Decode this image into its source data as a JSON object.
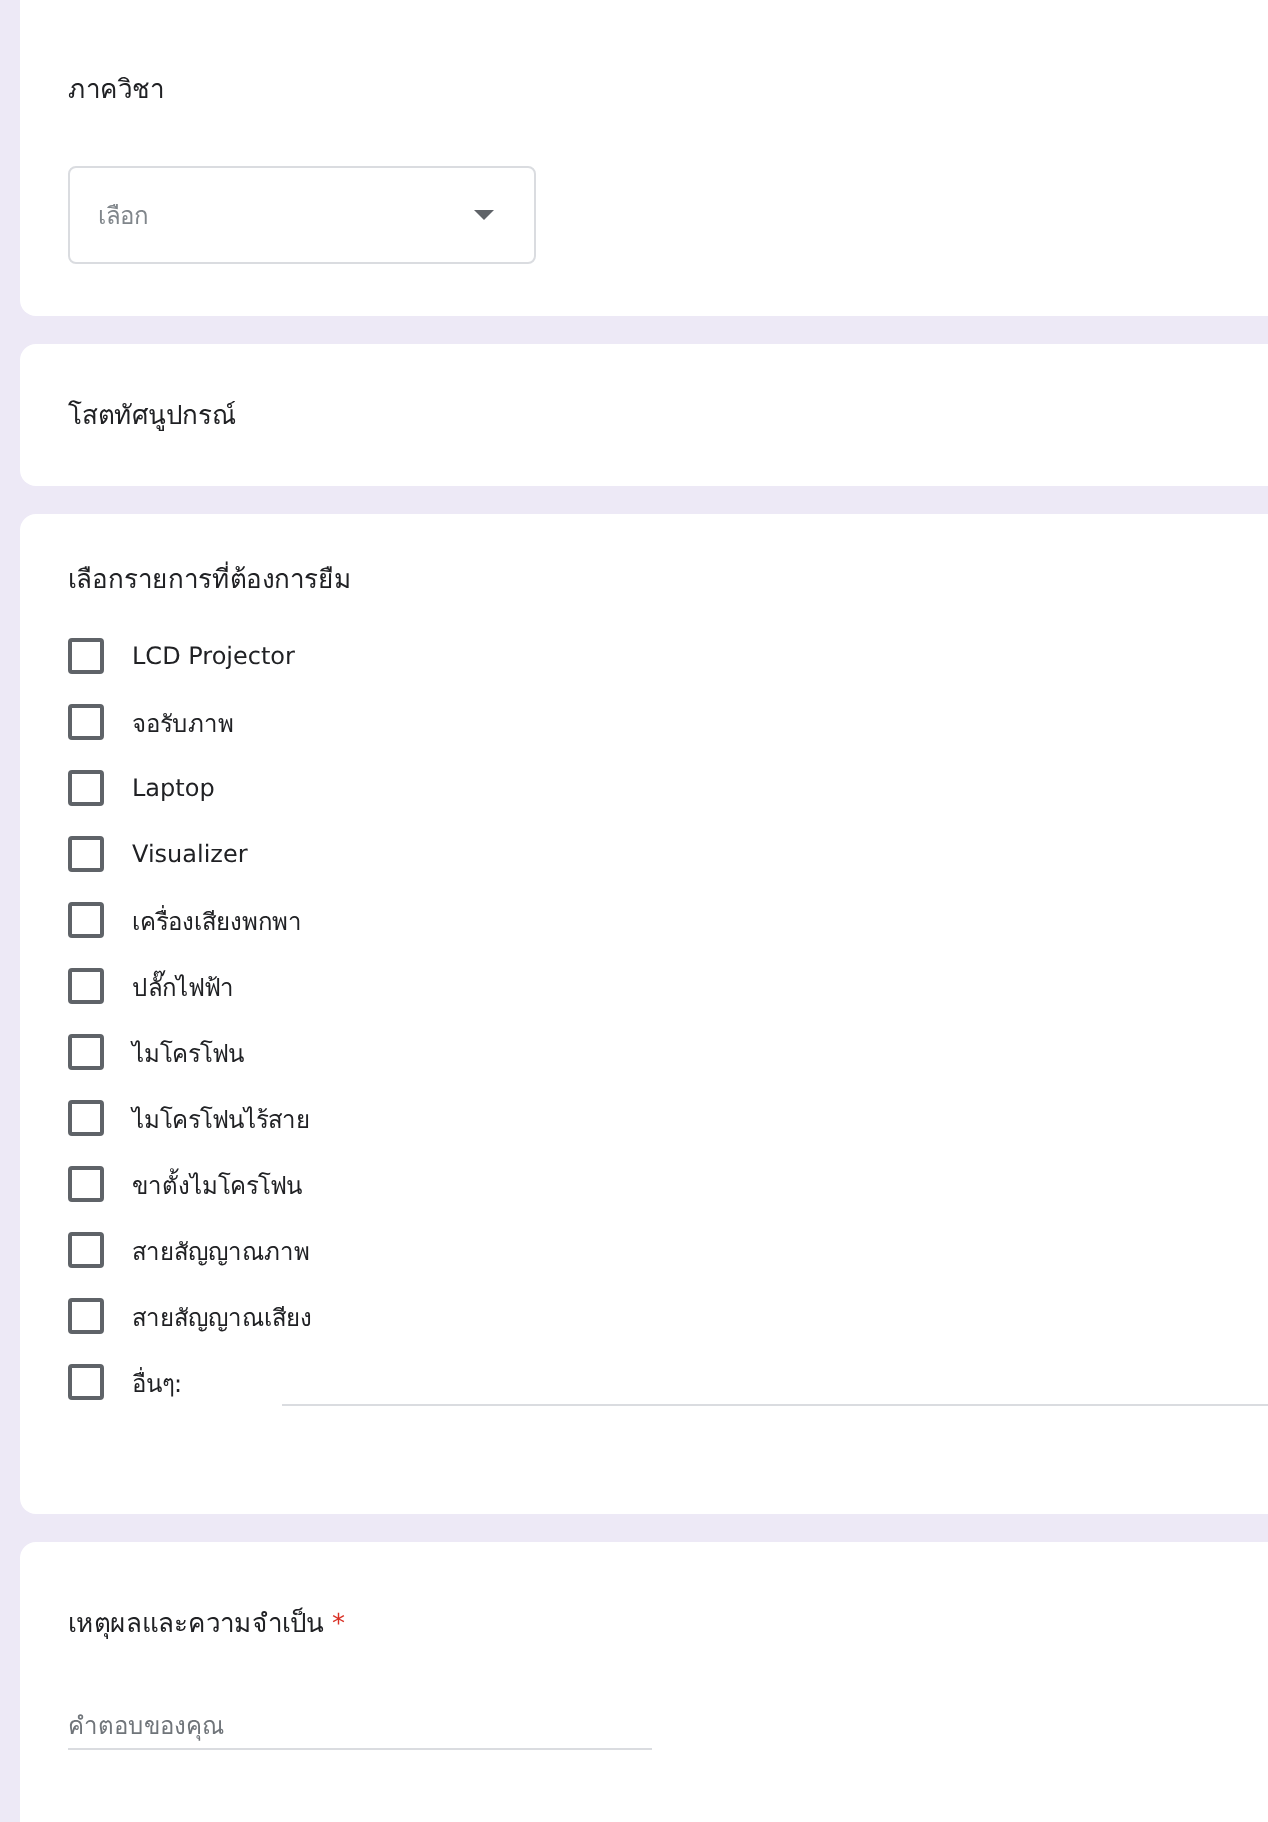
{
  "department": {
    "label": "ภาควิชา",
    "dropdown": {
      "placeholder": "เลือก"
    }
  },
  "section": {
    "title": "โสตทัศนูปกรณ์"
  },
  "equipment": {
    "label": "เลือกรายการที่ต้องการยืม",
    "options": [
      {
        "kind": "option",
        "label": "LCD Projector",
        "checked": false
      },
      {
        "kind": "option",
        "label": "จอรับภาพ",
        "checked": false
      },
      {
        "kind": "option",
        "label": "Laptop",
        "checked": false
      },
      {
        "kind": "option",
        "label": "Visualizer",
        "checked": false
      },
      {
        "kind": "option",
        "label": "เครื่องเสียงพกพา",
        "checked": false
      },
      {
        "kind": "option",
        "label": "ปลั๊กไฟฟ้า",
        "checked": false
      },
      {
        "kind": "option",
        "label": "ไมโครโฟน",
        "checked": false
      },
      {
        "kind": "option",
        "label": "ไมโครโฟนไร้สาย",
        "checked": false
      },
      {
        "kind": "option",
        "label": "ขาตั้งไมโครโฟน",
        "checked": false
      },
      {
        "kind": "option",
        "label": "สายสัญญาณภาพ",
        "checked": false
      },
      {
        "kind": "option",
        "label": "สายสัญญาณเสียง",
        "checked": false
      },
      {
        "kind": "other",
        "label": "อื่นๆ:",
        "checked": false
      }
    ]
  },
  "reason": {
    "label": "เหตุผลและความจำเป็น",
    "required": true,
    "required_mark": "*",
    "placeholder": "คำตอบของคุณ"
  }
}
